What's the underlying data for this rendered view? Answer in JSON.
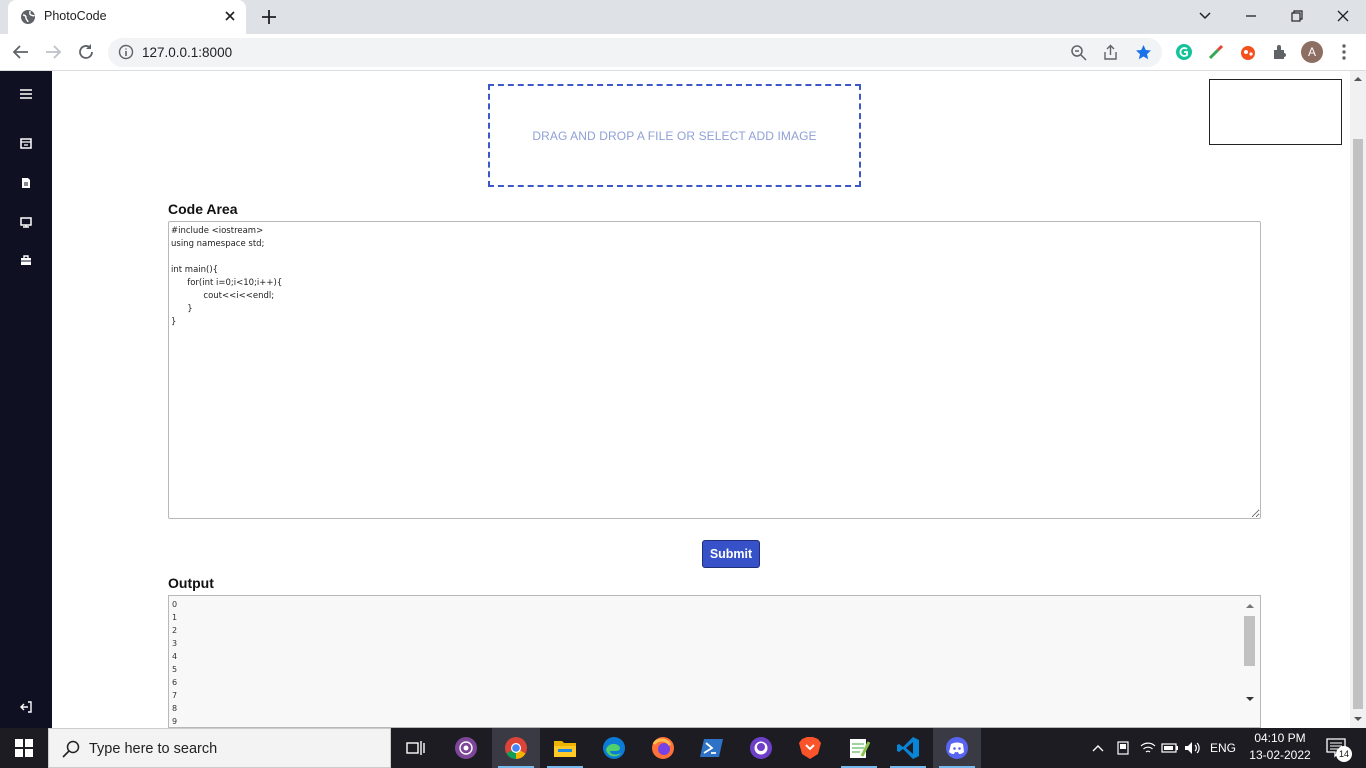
{
  "browser": {
    "tab_title": "PhotoCode",
    "url": "127.0.0.1:8000",
    "profile_initial": "A"
  },
  "sidebar": {
    "icons": [
      "menu-icon",
      "calendar-icon",
      "document-icon",
      "monitor-icon",
      "briefcase-icon",
      "logout-icon"
    ]
  },
  "upload": {
    "dropzone_text": "DRAG AND DROP A FILE OR SELECT ADD IMAGE"
  },
  "code": {
    "label": "Code Area",
    "value": "#include <iostream>\nusing namespace std;\n\nint main(){\n      for(int i=0;i<10;i++){\n            cout<<i<<endl;\n      }\n}"
  },
  "submit_label": "Submit",
  "output": {
    "label": "Output",
    "lines": [
      "0",
      "1",
      "2",
      "3",
      "4",
      "5",
      "6",
      "7",
      "8",
      "9"
    ]
  },
  "taskbar": {
    "search_placeholder": "Type here to search",
    "language": "ENG",
    "time": "04:10 PM",
    "date": "13-02-2022",
    "notification_count": "14"
  },
  "colors": {
    "sidebar_bg": "#0f1123",
    "accent": "#3752c8",
    "dropzone_border": "#3b57c8"
  }
}
